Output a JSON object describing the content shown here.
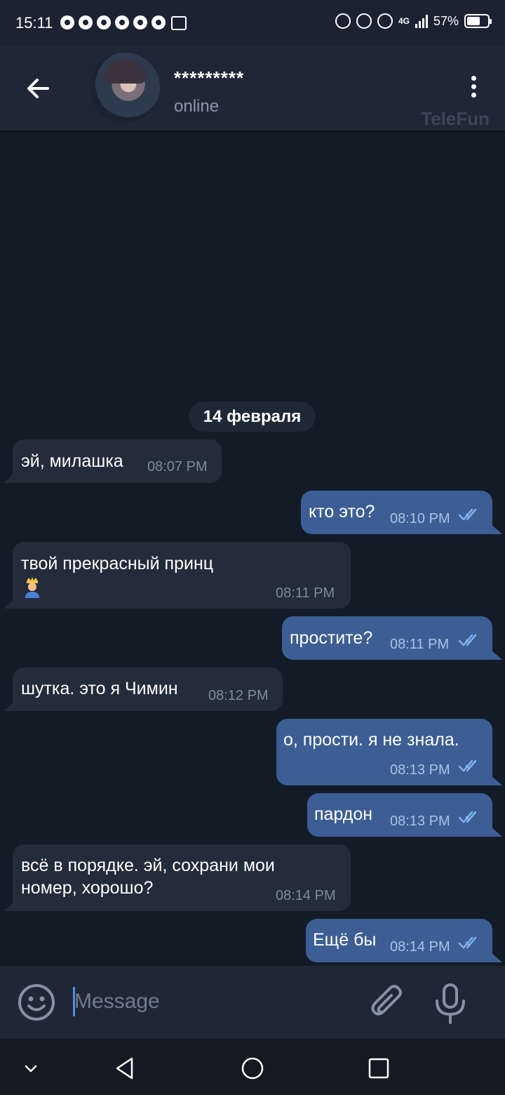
{
  "status_bar": {
    "time": "15:11",
    "battery": "57%",
    "network": "4G",
    "notification_icons": [
      "messenger-icon",
      "chrome-icon",
      "chrome-icon",
      "chrome-icon",
      "chrome-icon",
      "chrome-icon",
      "gallery-icon"
    ],
    "right_icons": [
      "hotspot-icon",
      "alarm-icon",
      "mute-icon",
      "signal-icon",
      "battery-icon"
    ]
  },
  "header": {
    "contact_name": "*********",
    "status": "online",
    "watermark": "TeleFun"
  },
  "chat": {
    "date": "14 февраля",
    "messages": [
      {
        "dir": "in",
        "text": "эй, милашка",
        "time": "08:07 PM"
      },
      {
        "dir": "out",
        "text": "кто это?",
        "time": "08:10 PM",
        "read": true
      },
      {
        "dir": "in",
        "text": "твой прекрасный принц",
        "emoji": "prince-emoji",
        "time": "08:11 PM"
      },
      {
        "dir": "out",
        "text": "простите?",
        "time": "08:11 PM",
        "read": true
      },
      {
        "dir": "in",
        "text": "шутка. это я Чимин",
        "time": "08:12 PM"
      },
      {
        "dir": "out",
        "text": "о, прости. я не знала.",
        "time": "08:13 PM",
        "read": true
      },
      {
        "dir": "out",
        "text": "пардон",
        "time": "08:13 PM",
        "read": true
      },
      {
        "dir": "in",
        "text_lines": [
          "всё в порядке. эй, сохрани мои",
          "номер, хорошо?"
        ],
        "time": "08:14 PM"
      },
      {
        "dir": "out",
        "text": "Ещё бы",
        "time": "08:14 PM",
        "read": true
      }
    ]
  },
  "input": {
    "placeholder": "Message"
  },
  "colors": {
    "background": "#131b27",
    "incoming_bubble": "#222c3b",
    "outgoing_bubble": "#3d5e94",
    "header": "#1f2736",
    "accent": "#4f8fe6"
  }
}
